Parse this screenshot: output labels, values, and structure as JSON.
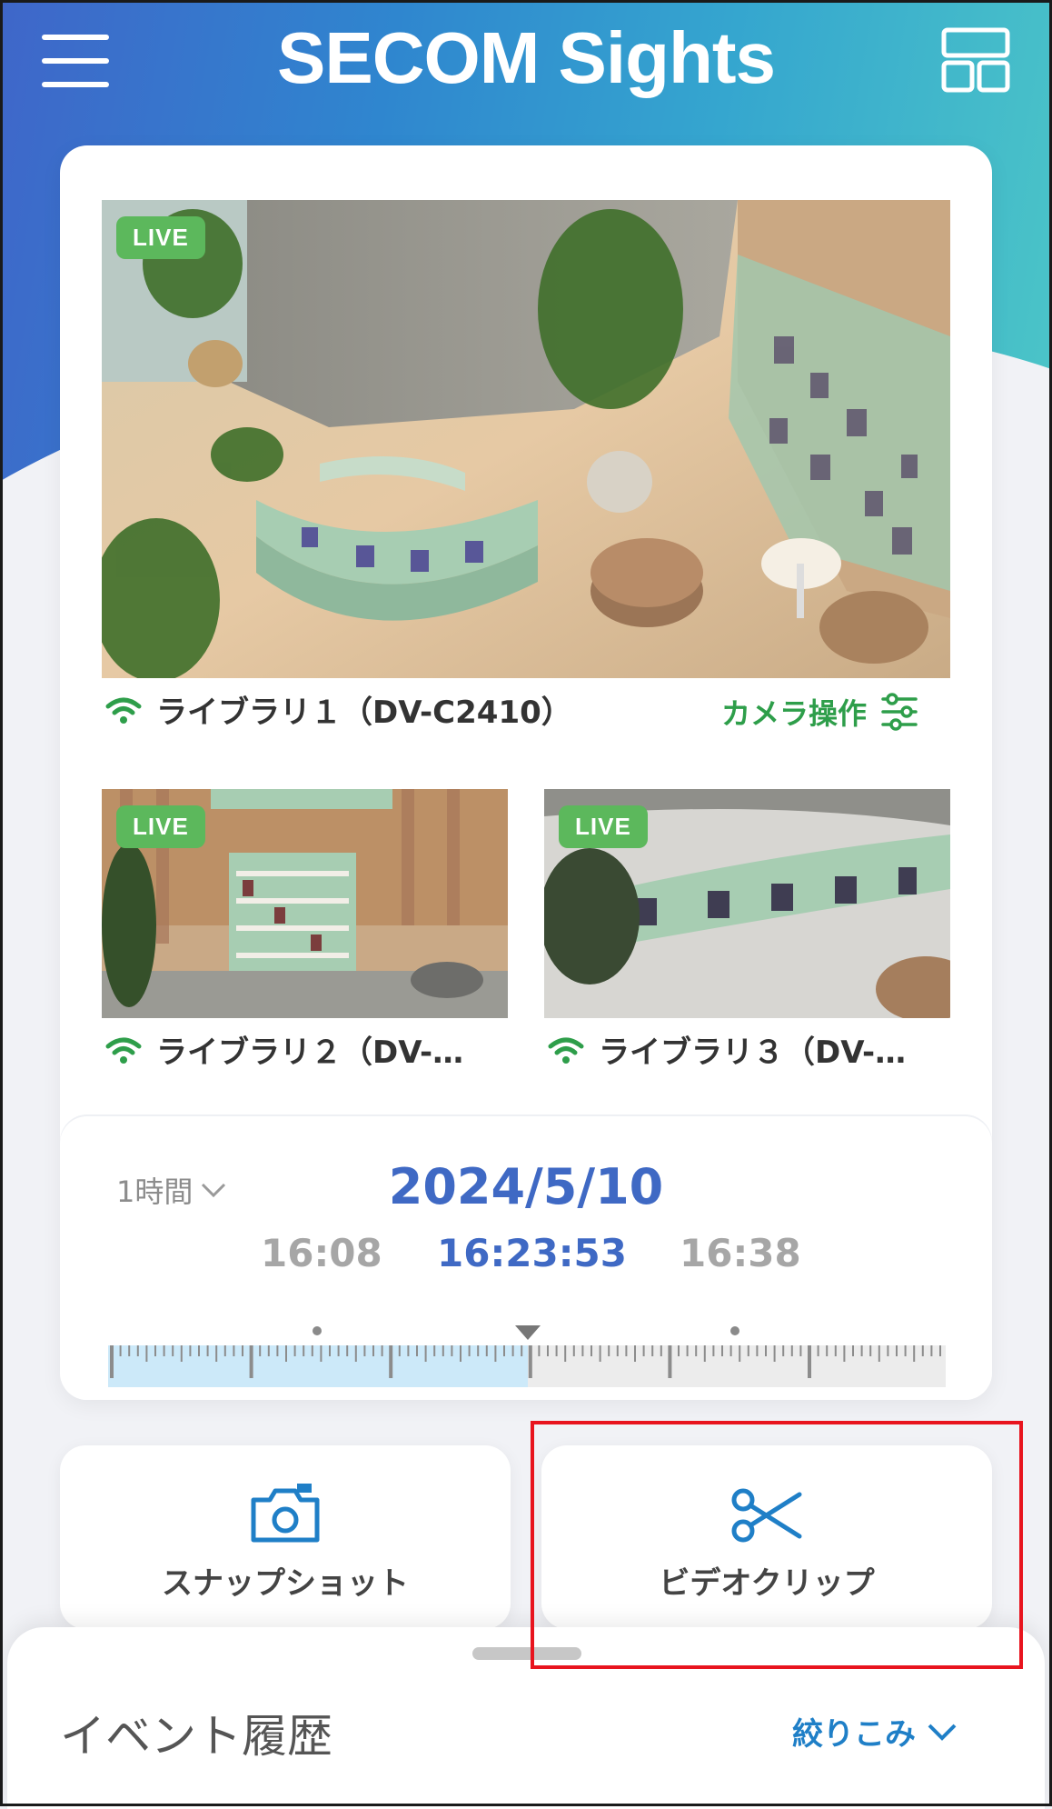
{
  "header": {
    "title": "SECOM Sights",
    "menu_icon": "hamburger-menu-icon",
    "layout_icon": "layout-grid-icon"
  },
  "cameras": {
    "main": {
      "badge": "LIVE",
      "name": "ライブラリ１（DV-C2410）",
      "operation_label": "カメラ操作"
    },
    "sub": [
      {
        "badge": "LIVE",
        "name": "ライブラリ２（DV-…"
      },
      {
        "badge": "LIVE",
        "name": "ライブラリ３（DV-…"
      }
    ]
  },
  "timeline": {
    "range": "1時間",
    "date": "2024/5/10",
    "times": {
      "prev": "16:08",
      "current": "16:23:53",
      "next": "16:38"
    }
  },
  "actions": {
    "snapshot": "スナップショット",
    "video_clip": "ビデオクリップ"
  },
  "events": {
    "title": "イベント履歴",
    "filter": "絞りこみ"
  },
  "colors": {
    "accent_blue": "#3f69c4",
    "live_green": "#5cb85c",
    "op_green": "#2e9e4a",
    "link_blue": "#1f7fc7",
    "highlight_red": "#e8141e"
  }
}
